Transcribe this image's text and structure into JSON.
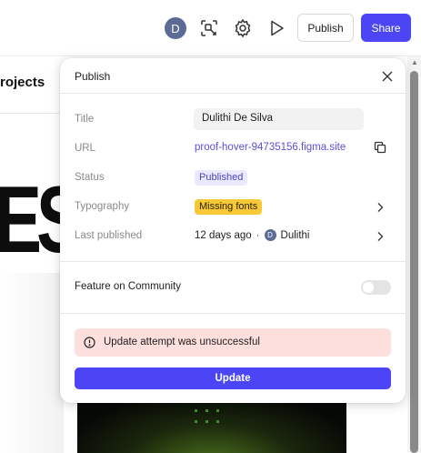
{
  "toolbar": {
    "avatar_initial": "D",
    "publish_label": "Publish",
    "share_label": "Share",
    "icons": [
      "inspect-icon",
      "settings-icon",
      "play-icon"
    ]
  },
  "background": {
    "projects_label": "rojects",
    "headline": "ES"
  },
  "panel": {
    "title": "Publish",
    "rows": {
      "title_label": "Title",
      "title_value": "Dulithi De Silva",
      "url_label": "URL",
      "url_value": "proof-hover-94735156.figma.site",
      "status_label": "Status",
      "status_value": "Published",
      "typography_label": "Typography",
      "typography_value": "Missing fonts",
      "last_published_label": "Last published",
      "last_published_time": "12 days ago",
      "last_published_separator": "·",
      "last_published_user_initial": "D",
      "last_published_user": "Dulithi"
    },
    "community": {
      "label": "Feature on Community",
      "enabled": false
    },
    "error": {
      "message": "Update attempt was unsuccessful"
    },
    "update_label": "Update"
  },
  "colors": {
    "accent": "#4b45f5",
    "link": "#5a4fd8",
    "published_badge_bg": "#ebe9fd",
    "missing_badge_bg": "#f8c937",
    "error_bg": "#fde0dd"
  }
}
